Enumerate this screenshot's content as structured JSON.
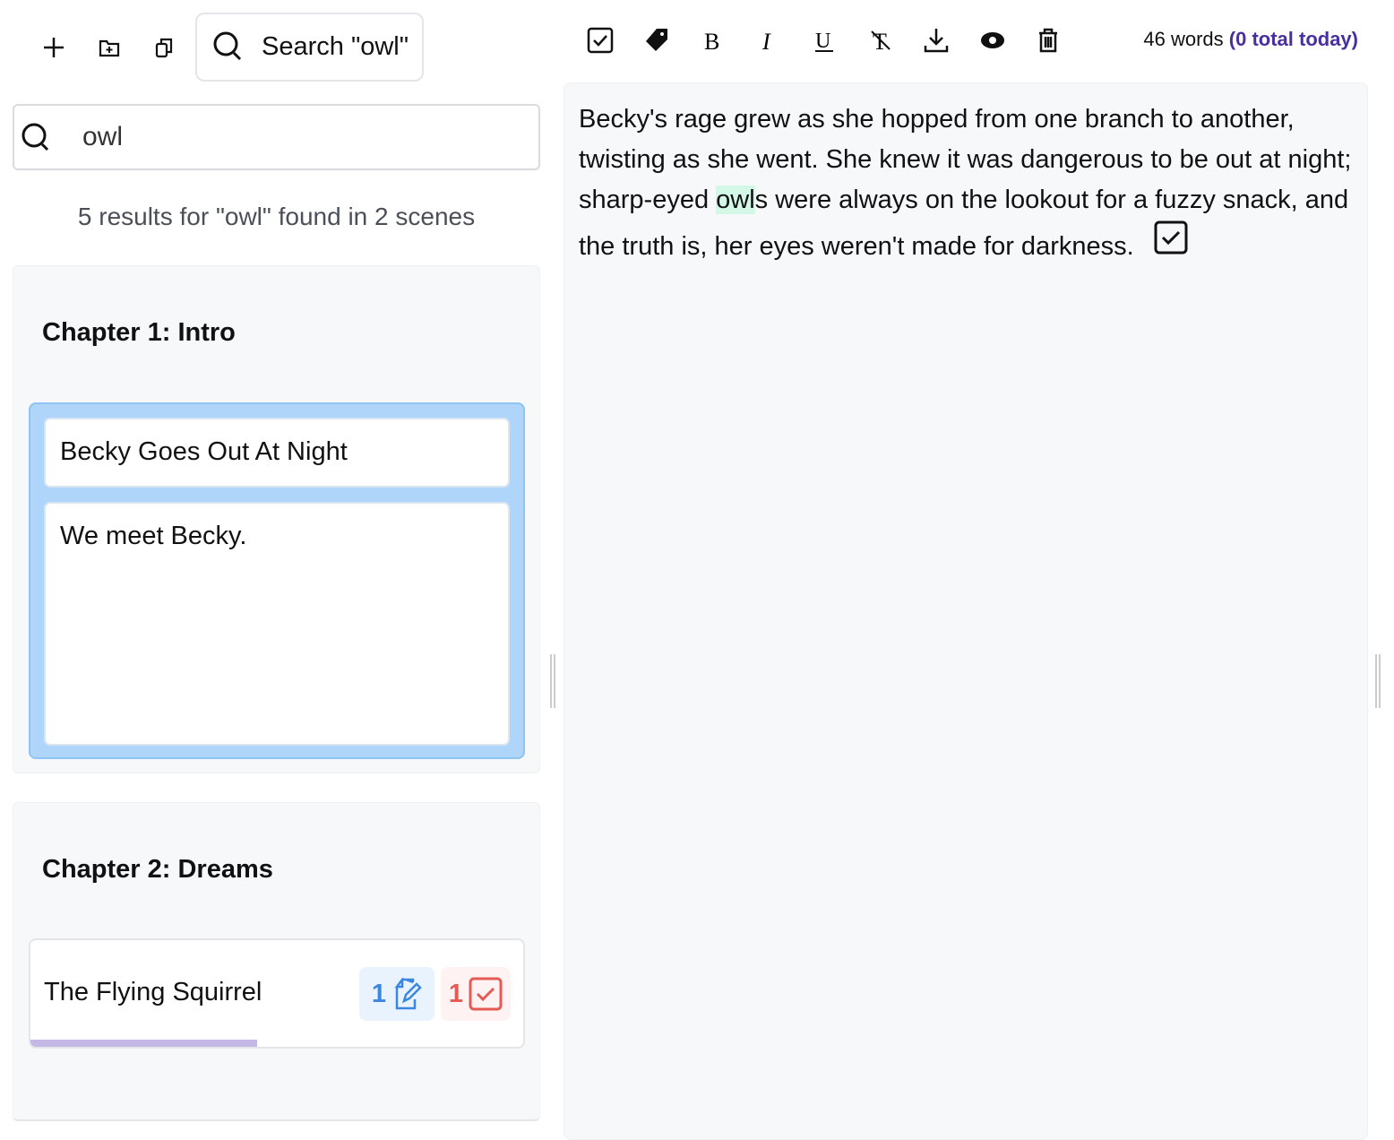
{
  "sidebar": {
    "toolbar": {
      "add_icon": "plus-icon",
      "add_folder_icon": "folder-plus-icon",
      "duplicate_icon": "copy-icon",
      "search_button_label": "Search \"owl\""
    },
    "search": {
      "value": "owl",
      "placeholder": ""
    },
    "results_summary": "5 results for \"owl\" found in 2 scenes",
    "chapters": [
      {
        "title": "Chapter 1: Intro",
        "scenes": [
          {
            "title": "Becky Goes Out At Night",
            "summary": "We meet Becky.",
            "selected": true
          }
        ]
      },
      {
        "title": "Chapter 2: Dreams",
        "scenes": [
          {
            "title": "The Flying Squirrel",
            "notes_count": "1",
            "tasks_count": "1",
            "progress_percent": 46
          }
        ]
      }
    ]
  },
  "editor": {
    "toolbar": [
      "checkbox-icon",
      "tag-icon",
      "bold-icon",
      "italic-icon",
      "underline-icon",
      "clear-format-icon",
      "download-icon",
      "eye-icon",
      "trash-icon"
    ],
    "word_count": "46 words",
    "today_count": "(0 total today)",
    "text_before": "Becky's rage grew as she hopped from one branch to another, twisting as she went. She knew it was dangerous to be out at night; sharp-eyed ",
    "text_highlight": "owl",
    "text_after": "s were always on the lookout for a fuzzy snack, and the truth is, her eyes weren't made for darkness."
  },
  "colors": {
    "accent": "#4a2fa0",
    "highlight": "#d3f8e8",
    "selected_scene": "#afd6fa",
    "notes": "#3b87e0",
    "tasks": "#e45a55",
    "progress": "#c5b8e6"
  }
}
